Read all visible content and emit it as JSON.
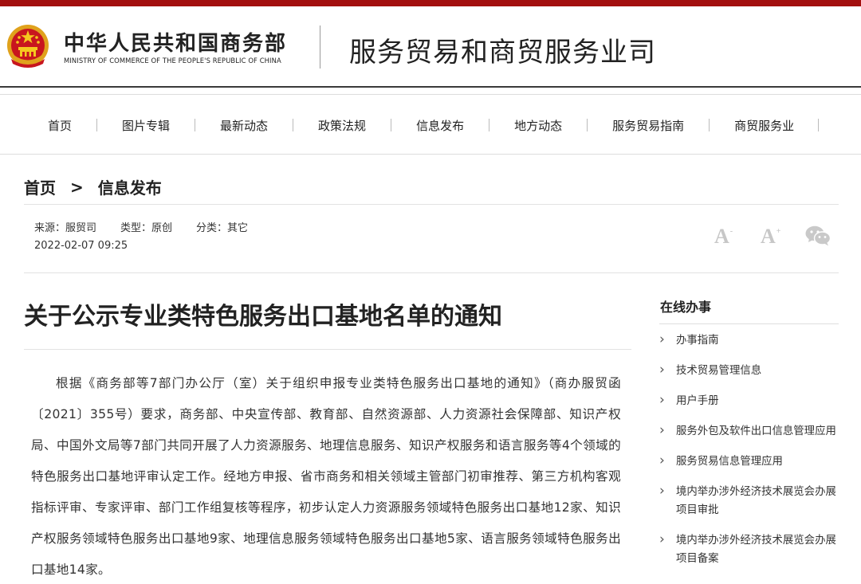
{
  "header": {
    "ministry_cn": "中华人民共和国商务部",
    "ministry_en": "MINISTRY OF COMMERCE OF THE PEOPLE'S REPUBLIC OF CHINA",
    "dept_title": "服务贸易和商贸服务业司",
    "accent_color": "#a3100f"
  },
  "nav": {
    "items": [
      "首页",
      "图片专辑",
      "最新动态",
      "政策法规",
      "信息发布",
      "地方动态",
      "服务贸易指南",
      "商贸服务业"
    ]
  },
  "breadcrumb": {
    "home": "首页",
    "separator": ">",
    "current": "信息发布"
  },
  "meta": {
    "source": "来源：服贸司",
    "type": "类型：原创",
    "category": "分类：其它",
    "date": "2022-02-07 09:25"
  },
  "tools": {
    "font_glyph": "A",
    "font_small_suffix": "-",
    "font_large_suffix": "+",
    "share_icon": "wechat-icon"
  },
  "article": {
    "title": "关于公示专业类特色服务出口基地名单的通知",
    "body": "根据《商务部等7部门办公厅（室）关于组织申报专业类特色服务出口基地的通知》（商办服贸函〔2021〕355号）要求，商务部、中央宣传部、教育部、自然资源部、人力资源社会保障部、知识产权局、中国外文局等7部门共同开展了人力资源服务、地理信息服务、知识产权服务和语言服务等4个领域的特色服务出口基地评审认定工作。经地方申报、省市商务和相关领域主管部门初审推荐、第三方机构客观指标评审、专家评审、部门工作组复核等程序，初步认定人力资源服务领域特色服务出口基地12家、知识产权服务领域特色服务出口基地9家、地理信息服务领域特色服务出口基地5家、语言服务领域特色服务出口基地14家。"
  },
  "sidebar": {
    "title": "在线办事",
    "items": [
      "办事指南",
      "技术贸易管理信息",
      "用户手册",
      "服务外包及软件出口信息管理应用",
      "服务贸易信息管理应用",
      "境内举办涉外经济技术展览会办展项目审批",
      "境内举办涉外经济技术展览会办展项目备案"
    ]
  }
}
